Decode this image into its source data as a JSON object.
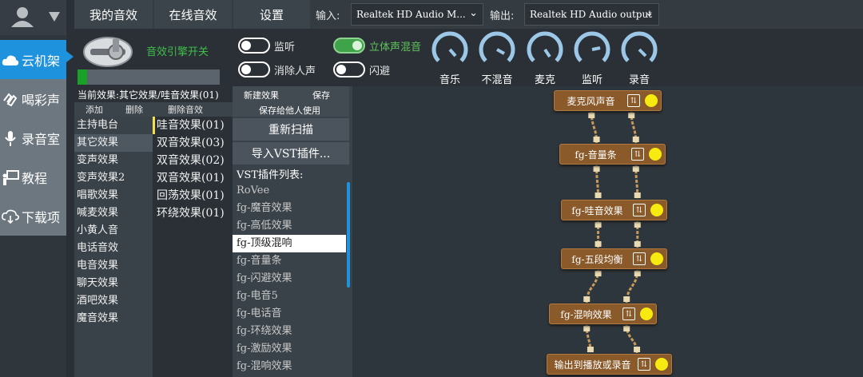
{
  "nav": {
    "tabs": [
      "我的音效",
      "在线音效",
      "设置"
    ],
    "sidebar": [
      "云机架",
      "喝彩声",
      "录音室",
      "教程",
      "下载项"
    ]
  },
  "io": {
    "input_label": "输入:",
    "input_value": "Realtek HD Audio M...",
    "output_label": "输出:",
    "output_value": "Realtek HD Audio output"
  },
  "engine": {
    "switch_label": "音效引擎开关",
    "level": 0.07
  },
  "toggles": {
    "monitor": "监听",
    "remove_vocal": "消除人声",
    "stereo_mix": "立体声混音",
    "ducking": "闪避"
  },
  "knobs": [
    "音乐",
    "不混音",
    "麦克",
    "监听",
    "录音"
  ],
  "effects": {
    "current": "当前效果:其它效果/哇音效果(01)",
    "add": "添加",
    "delete": "删除",
    "delete_effect": "删除音效",
    "categories": [
      "主持电台",
      "其它效果",
      "变声效果",
      "变声效果2",
      "唱歌效果",
      "喊麦效果",
      "小黄人音",
      "电话音效",
      "电音效果",
      "聊天效果",
      "酒吧效果",
      "魔音效果"
    ],
    "presets": [
      "哇音效果(01)",
      "双音效果(03)",
      "双音效果(02)",
      "双音效果(01)",
      "回荡效果(01)",
      "环绕效果(01)"
    ]
  },
  "vst": {
    "new_effect": "新建效果",
    "save": "保存",
    "save_share": "保存给他人使用",
    "rescan": "重新扫描",
    "import": "导入VST插件...",
    "list_title": "VST插件列表:",
    "plugins": [
      "RoVee",
      "fg-魔音效果",
      "fg-高低效果",
      "fg-顶级混响",
      "fg-音量条",
      "fg-闪避效果",
      "fg-电音5",
      "fg-电话音",
      "fg-环绕效果",
      "fg-激励效果",
      "fg-混响效果"
    ]
  },
  "chain": [
    "麦克风声音",
    "fg-音量条",
    "fg-哇音效果",
    "fg-五段均衡",
    "fg-混响效果",
    "输出到播放或录音"
  ],
  "colors": {
    "accent": "#1e92dc",
    "node": "#8a5a2b",
    "led": "#f6ea11",
    "on": "#3fa34a"
  }
}
